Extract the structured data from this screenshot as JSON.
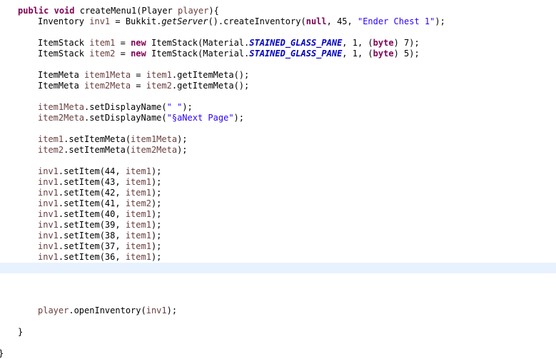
{
  "editor": {
    "current_line_color": "#e8f2fe",
    "colors": {
      "keyword": "#7f0055",
      "string": "#2a00ff",
      "local_variable": "#6a3e3e",
      "constant": "#0000c0",
      "plain": "#000000"
    },
    "lines": [
      {
        "indent": 1,
        "tokens": [
          {
            "t": "kw",
            "s": "public"
          },
          {
            "t": "plain",
            "s": " "
          },
          {
            "t": "kw",
            "s": "void"
          },
          {
            "t": "plain",
            "s": " createMenu1(Player "
          },
          {
            "t": "var",
            "s": "player"
          },
          {
            "t": "plain",
            "s": "){"
          }
        ]
      },
      {
        "indent": 2,
        "tokens": [
          {
            "t": "plain",
            "s": "Inventory "
          },
          {
            "t": "var",
            "s": "inv1"
          },
          {
            "t": "plain",
            "s": " = Bukkit."
          },
          {
            "t": "static",
            "s": "getServer"
          },
          {
            "t": "plain",
            "s": "().createInventory("
          },
          {
            "t": "kw",
            "s": "null"
          },
          {
            "t": "plain",
            "s": ", 45, "
          },
          {
            "t": "str",
            "s": "\"Ender Chest 1\""
          },
          {
            "t": "plain",
            "s": ");"
          }
        ]
      },
      {
        "indent": 0,
        "tokens": []
      },
      {
        "indent": 2,
        "tokens": [
          {
            "t": "plain",
            "s": "ItemStack "
          },
          {
            "t": "var",
            "s": "item1"
          },
          {
            "t": "plain",
            "s": " = "
          },
          {
            "t": "kw",
            "s": "new"
          },
          {
            "t": "plain",
            "s": " ItemStack(Material."
          },
          {
            "t": "const",
            "s": "STAINED_GLASS_PANE"
          },
          {
            "t": "plain",
            "s": ", 1, ("
          },
          {
            "t": "kw",
            "s": "byte"
          },
          {
            "t": "plain",
            "s": ") 7);"
          }
        ]
      },
      {
        "indent": 2,
        "tokens": [
          {
            "t": "plain",
            "s": "ItemStack "
          },
          {
            "t": "var",
            "s": "item2"
          },
          {
            "t": "plain",
            "s": " = "
          },
          {
            "t": "kw",
            "s": "new"
          },
          {
            "t": "plain",
            "s": " ItemStack(Material."
          },
          {
            "t": "const",
            "s": "STAINED_GLASS_PANE"
          },
          {
            "t": "plain",
            "s": ", 1, ("
          },
          {
            "t": "kw",
            "s": "byte"
          },
          {
            "t": "plain",
            "s": ") 5);"
          }
        ]
      },
      {
        "indent": 0,
        "tokens": []
      },
      {
        "indent": 2,
        "tokens": [
          {
            "t": "plain",
            "s": "ItemMeta "
          },
          {
            "t": "var",
            "s": "item1Meta"
          },
          {
            "t": "plain",
            "s": " = "
          },
          {
            "t": "var",
            "s": "item1"
          },
          {
            "t": "plain",
            "s": ".getItemMeta();"
          }
        ]
      },
      {
        "indent": 2,
        "tokens": [
          {
            "t": "plain",
            "s": "ItemMeta "
          },
          {
            "t": "var",
            "s": "item2Meta"
          },
          {
            "t": "plain",
            "s": " = "
          },
          {
            "t": "var",
            "s": "item2"
          },
          {
            "t": "plain",
            "s": ".getItemMeta();"
          }
        ]
      },
      {
        "indent": 0,
        "tokens": []
      },
      {
        "indent": 2,
        "tokens": [
          {
            "t": "var",
            "s": "item1Meta"
          },
          {
            "t": "plain",
            "s": ".setDisplayName("
          },
          {
            "t": "str",
            "s": "\" \""
          },
          {
            "t": "plain",
            "s": ");"
          }
        ]
      },
      {
        "indent": 2,
        "tokens": [
          {
            "t": "var",
            "s": "item2Meta"
          },
          {
            "t": "plain",
            "s": ".setDisplayName("
          },
          {
            "t": "str",
            "s": "\"§aNext Page\""
          },
          {
            "t": "plain",
            "s": ");"
          }
        ]
      },
      {
        "indent": 0,
        "tokens": []
      },
      {
        "indent": 2,
        "tokens": [
          {
            "t": "var",
            "s": "item1"
          },
          {
            "t": "plain",
            "s": ".setItemMeta("
          },
          {
            "t": "var",
            "s": "item1Meta"
          },
          {
            "t": "plain",
            "s": ");"
          }
        ]
      },
      {
        "indent": 2,
        "tokens": [
          {
            "t": "var",
            "s": "item2"
          },
          {
            "t": "plain",
            "s": ".setItemMeta("
          },
          {
            "t": "var",
            "s": "item2Meta"
          },
          {
            "t": "plain",
            "s": ");"
          }
        ]
      },
      {
        "indent": 0,
        "tokens": []
      },
      {
        "indent": 2,
        "tokens": [
          {
            "t": "var",
            "s": "inv1"
          },
          {
            "t": "plain",
            "s": ".setItem(44, "
          },
          {
            "t": "var",
            "s": "item1"
          },
          {
            "t": "plain",
            "s": ");"
          }
        ]
      },
      {
        "indent": 2,
        "tokens": [
          {
            "t": "var",
            "s": "inv1"
          },
          {
            "t": "plain",
            "s": ".setItem(43, "
          },
          {
            "t": "var",
            "s": "item1"
          },
          {
            "t": "plain",
            "s": ");"
          }
        ]
      },
      {
        "indent": 2,
        "tokens": [
          {
            "t": "var",
            "s": "inv1"
          },
          {
            "t": "plain",
            "s": ".setItem(42, "
          },
          {
            "t": "var",
            "s": "item1"
          },
          {
            "t": "plain",
            "s": ");"
          }
        ]
      },
      {
        "indent": 2,
        "tokens": [
          {
            "t": "var",
            "s": "inv1"
          },
          {
            "t": "plain",
            "s": ".setItem(41, "
          },
          {
            "t": "var",
            "s": "item2"
          },
          {
            "t": "plain",
            "s": ");"
          }
        ]
      },
      {
        "indent": 2,
        "tokens": [
          {
            "t": "var",
            "s": "inv1"
          },
          {
            "t": "plain",
            "s": ".setItem(40, "
          },
          {
            "t": "var",
            "s": "item1"
          },
          {
            "t": "plain",
            "s": ");"
          }
        ]
      },
      {
        "indent": 2,
        "tokens": [
          {
            "t": "var",
            "s": "inv1"
          },
          {
            "t": "plain",
            "s": ".setItem(39, "
          },
          {
            "t": "var",
            "s": "item1"
          },
          {
            "t": "plain",
            "s": ");"
          }
        ]
      },
      {
        "indent": 2,
        "tokens": [
          {
            "t": "var",
            "s": "inv1"
          },
          {
            "t": "plain",
            "s": ".setItem(38, "
          },
          {
            "t": "var",
            "s": "item1"
          },
          {
            "t": "plain",
            "s": ");"
          }
        ]
      },
      {
        "indent": 2,
        "tokens": [
          {
            "t": "var",
            "s": "inv1"
          },
          {
            "t": "plain",
            "s": ".setItem(37, "
          },
          {
            "t": "var",
            "s": "item1"
          },
          {
            "t": "plain",
            "s": ");"
          }
        ]
      },
      {
        "indent": 2,
        "tokens": [
          {
            "t": "var",
            "s": "inv1"
          },
          {
            "t": "plain",
            "s": ".setItem(36, "
          },
          {
            "t": "var",
            "s": "item1"
          },
          {
            "t": "plain",
            "s": ");"
          }
        ]
      },
      {
        "indent": 0,
        "tokens": [],
        "current": true
      },
      {
        "indent": 0,
        "tokens": []
      },
      {
        "indent": 0,
        "tokens": []
      },
      {
        "indent": 0,
        "tokens": []
      },
      {
        "indent": 2,
        "tokens": [
          {
            "t": "var",
            "s": "player"
          },
          {
            "t": "plain",
            "s": ".openInventory("
          },
          {
            "t": "var",
            "s": "inv1"
          },
          {
            "t": "plain",
            "s": ");"
          }
        ]
      },
      {
        "indent": 0,
        "tokens": []
      },
      {
        "indent": 1,
        "tokens": [
          {
            "t": "plain",
            "s": "}"
          }
        ]
      },
      {
        "indent": 0,
        "tokens": []
      },
      {
        "indent": 0,
        "tokens": [
          {
            "t": "plain",
            "s": "}"
          }
        ]
      }
    ]
  }
}
